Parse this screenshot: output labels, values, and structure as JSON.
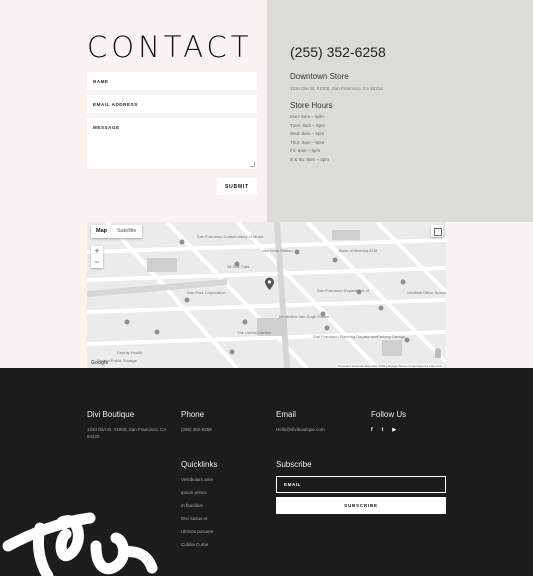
{
  "contact": {
    "title": "CONTACT",
    "fields": {
      "name_label": "NAME",
      "email_label": "EMAIL ADDRESS",
      "message_label": "MESSAGE"
    },
    "submit_label": "SUBMIT"
  },
  "info": {
    "phone": "(255) 352-6258",
    "store_heading": "Downtown Store",
    "store_address": "1234 Divi St. #1000, San Francisco, CA 93214",
    "hours_heading": "Store Hours",
    "hours": [
      "Mon: 8am – 5pm",
      "Tues: 8am – 5pm",
      "Wed: 8am – 5pm",
      "Thur: 8am – 5pm",
      "Fri: 8am – 5pm",
      "S & Su: 9am – 4pm"
    ]
  },
  "map": {
    "tabs": [
      "Map",
      "Satellite"
    ],
    "zoom_in": "+",
    "zoom_out": "−",
    "google": "Google",
    "footer_text": "Keyboard shortcuts   Map data ©2021 Google   Terms of Use   Report a map error"
  },
  "footer": {
    "brand": {
      "heading": "Divi  Boutique",
      "address": "1234 Divi St. #1000, San Francisco, CA 94220"
    },
    "phone": {
      "heading": "Phone",
      "value": "(255) 352-6258"
    },
    "email": {
      "heading": "Email",
      "value": "Hello@diviboutique.com"
    },
    "follow": {
      "heading": "Follow Us",
      "icons": [
        "f",
        "t",
        "▶"
      ]
    },
    "quicklinks": {
      "heading": "Quicklinks",
      "items": [
        "Vestibulum ante",
        "Ipsum primis",
        "In faucibus",
        "Orci luctus et",
        "Ultrices posuere",
        "Cubilia Curae"
      ]
    },
    "subscribe": {
      "heading": "Subscribe",
      "email_label": "EMAIL",
      "button_label": "SUBSCRIBE"
    }
  },
  "colors": {
    "top_left_bg": "#f7f3f0",
    "top_right_bg": "#dcdcd6",
    "footer_bg": "#1c1c1c"
  }
}
